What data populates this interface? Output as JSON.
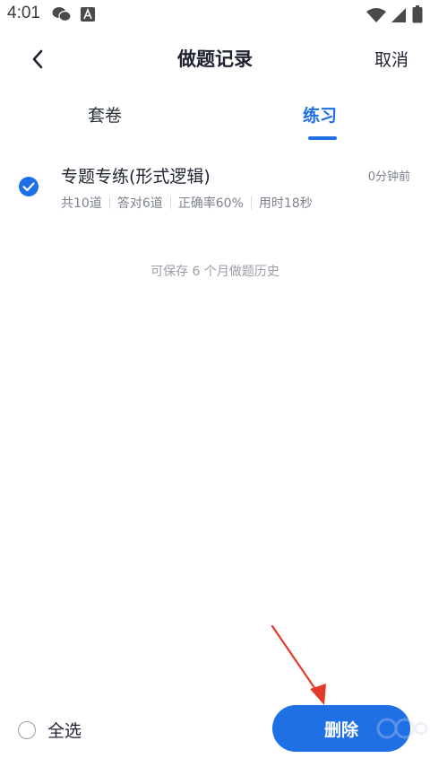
{
  "status_bar": {
    "time": "4:01",
    "icons": [
      "wechat-icon",
      "app-a-icon",
      "wifi-icon",
      "signal-icon",
      "battery-icon"
    ]
  },
  "header": {
    "title": "做题记录",
    "cancel_label": "取消",
    "back_icon": "chevron-left-icon"
  },
  "tabs": [
    {
      "label": "套卷",
      "active": false
    },
    {
      "label": "练习",
      "active": true
    }
  ],
  "records": [
    {
      "checked": true,
      "title": "专题专练(形式逻辑)",
      "time": "0分钟前",
      "stats": [
        "共10道",
        "答对6道",
        "正确率60%",
        "用时18秒"
      ]
    }
  ],
  "history_note": "可保存 6 个月做题历史",
  "footer": {
    "select_all_label": "全选",
    "delete_label": "删除"
  },
  "colors": {
    "accent": "#1f6fe5",
    "annotation": "#e5392b"
  }
}
